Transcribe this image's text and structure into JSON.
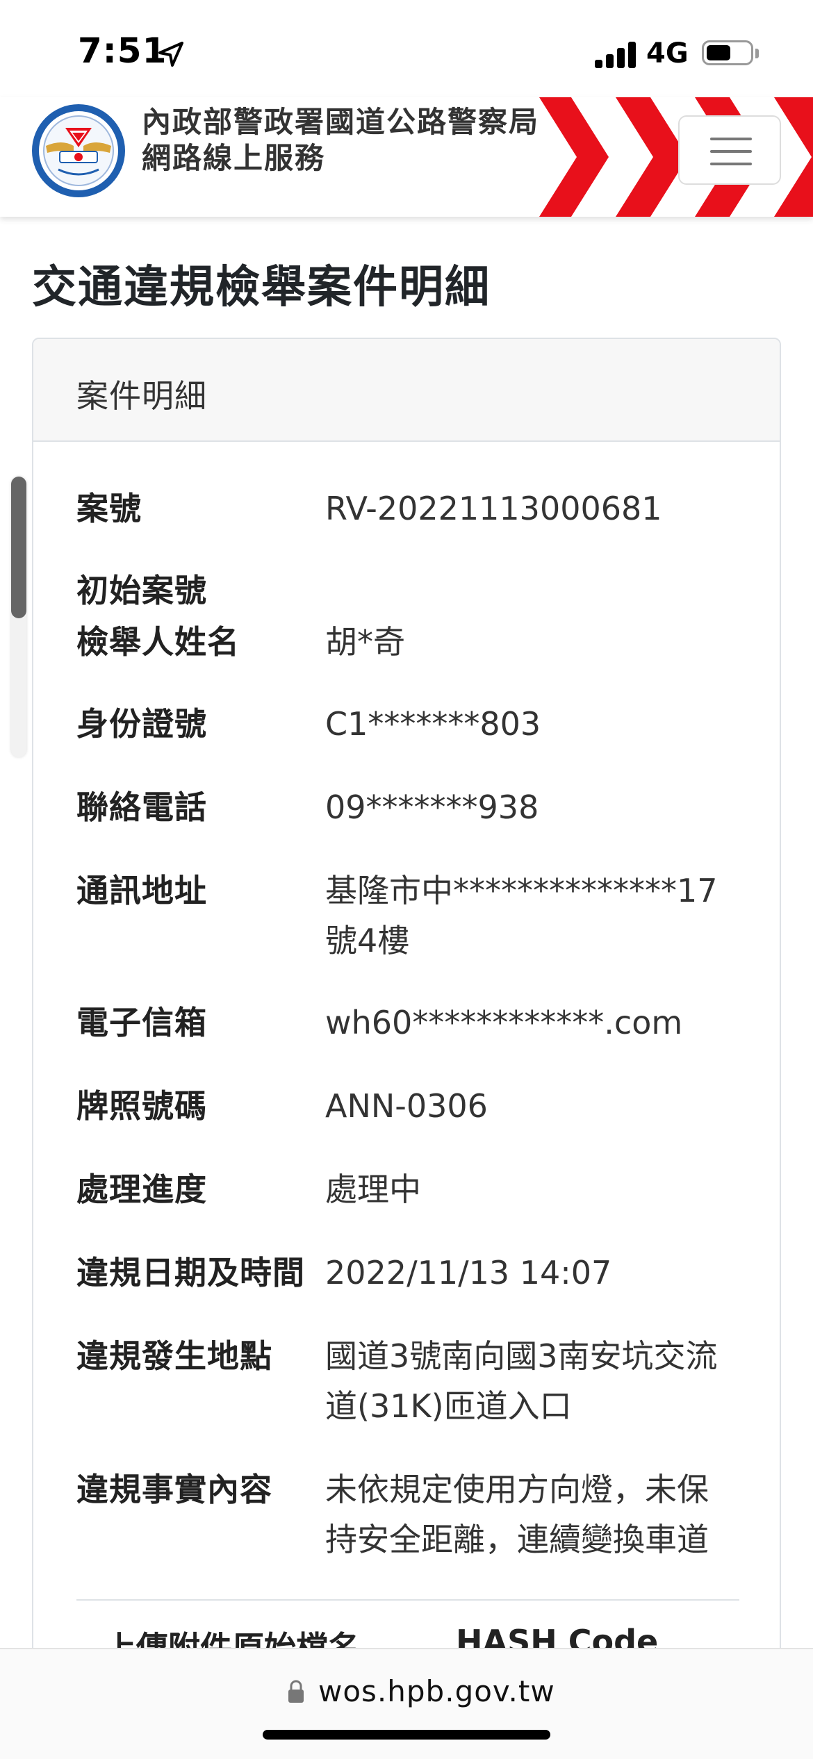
{
  "status_bar": {
    "time": "7:51",
    "network": "4G",
    "signal_bars": 4,
    "battery_level": 0.55
  },
  "header": {
    "agency_name": "內政部警政署國道公路警察局",
    "service_name": "網路線上服務",
    "menu_icon": "hamburger-icon",
    "accent_color": "#e8101b"
  },
  "page": {
    "title": "交通違規檢舉案件明細"
  },
  "card": {
    "header": "案件明細",
    "fields": [
      {
        "label": "案號",
        "value": "RV-20221113000681"
      },
      {
        "label": "初始案號",
        "value": ""
      },
      {
        "label": "檢舉人姓名",
        "value": "胡*奇"
      },
      {
        "label": "身份證號",
        "value": "C1*******803"
      },
      {
        "label": "聯絡電話",
        "value": "09*******938"
      },
      {
        "label": "通訊地址",
        "value": "基隆市中**************17號4樓"
      },
      {
        "label": "電子信箱",
        "value": "wh60************.com"
      },
      {
        "label": "牌照號碼",
        "value": "ANN-0306"
      },
      {
        "label": "處理進度",
        "value": "處理中"
      },
      {
        "label": "違規日期及時間",
        "value": "2022/11/13 14:07"
      },
      {
        "label": "違規發生地點",
        "value": "國道3號南向國3南安坑交流道(31K)匝道入口"
      },
      {
        "label": "違規事實內容",
        "value": "未依規定使用方向燈，未保持安全距離，連續變換車道"
      }
    ],
    "attachments_header": {
      "filename_col": "上傳附件原始檔名",
      "hash_col": "HASH Code"
    }
  },
  "browser": {
    "url": "wos.hpb.gov.tw",
    "lock_icon": "lock-icon"
  }
}
